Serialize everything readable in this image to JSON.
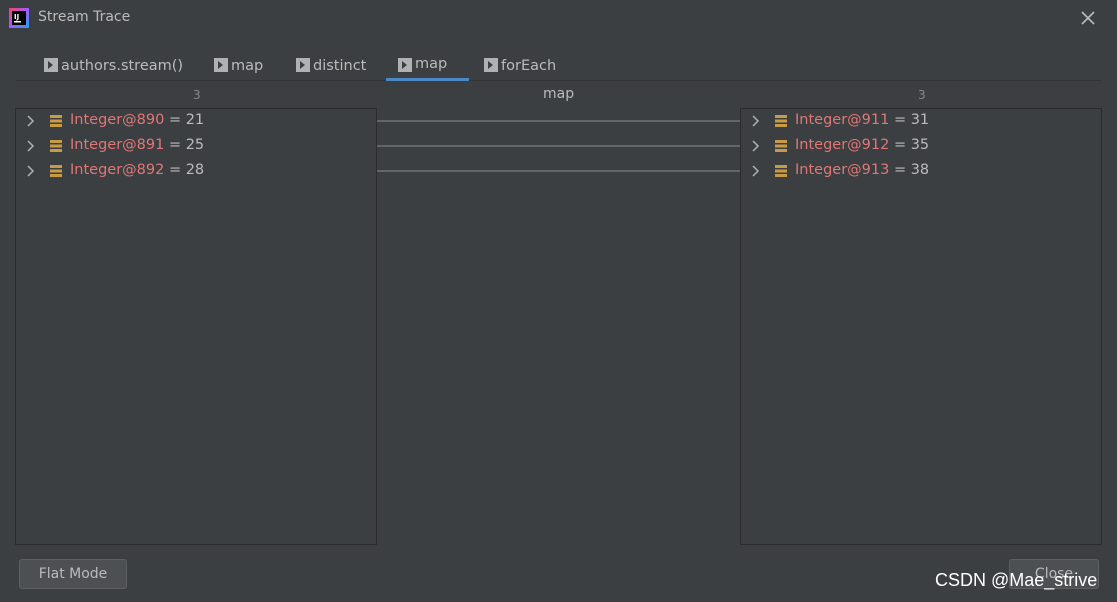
{
  "window": {
    "title": "Stream Trace"
  },
  "tabs": [
    {
      "label": "authors.stream()",
      "active": false
    },
    {
      "label": "map",
      "active": false
    },
    {
      "label": "distinct",
      "active": false
    },
    {
      "label": "map",
      "active": true
    },
    {
      "label": "forEach",
      "active": false
    }
  ],
  "left_panel": {
    "count": "3",
    "items": [
      {
        "name": "Integer@890",
        "value": " = 21"
      },
      {
        "name": "Integer@891",
        "value": " = 25"
      },
      {
        "name": "Integer@892",
        "value": " = 28"
      }
    ]
  },
  "middle": {
    "label": "map"
  },
  "right_panel": {
    "count": "3",
    "items": [
      {
        "name": "Integer@911",
        "value": " = 31"
      },
      {
        "name": "Integer@912",
        "value": " = 35"
      },
      {
        "name": "Integer@913",
        "value": " = 38"
      }
    ]
  },
  "buttons": {
    "flat_mode": "Flat Mode",
    "close": "Close"
  },
  "watermark": "CSDN @Mae_strive",
  "colors": {
    "accent": "#4a88c7",
    "item_name": "#e07777",
    "background": "#3c3f41"
  }
}
